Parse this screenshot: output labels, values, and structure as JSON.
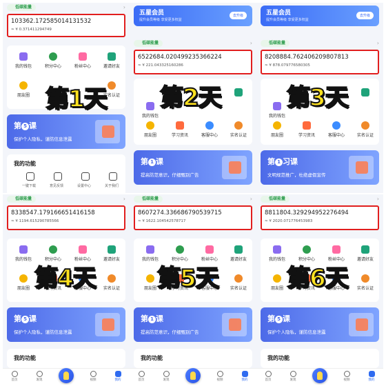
{
  "colors": {
    "accent": "#2f6bf0",
    "highlight_border": "#e11d1d",
    "day_text": "#ffe21f",
    "low_carbon": "#2e9d4f"
  },
  "member": {
    "title": "五星会员",
    "subtitle": "提升会员等级 享受更多权益",
    "button": "去升级"
  },
  "header": {
    "label": "低碳能量"
  },
  "quick": {
    "wallet": "我的钱包",
    "points": "积分中心",
    "fans": "粉丝中心",
    "invite": "邀请好友",
    "moments": "朋友圈",
    "study": "学习资讯",
    "service": "客服中心",
    "realname": "实名认证"
  },
  "my_functions": {
    "title": "我的功能",
    "items": [
      "一键下载",
      "意见反馈",
      "设置中心",
      "关于我们"
    ]
  },
  "tabs": {
    "home": "首页",
    "discover": "发现",
    "mall": "商城",
    "video": "视频",
    "mine": "我的"
  },
  "panels": [
    {
      "day": "第1天",
      "energy": "103362.172585014131532",
      "rmb": "≈ ¥ 0.371411294749",
      "lesson_no": "5",
      "lesson_word": "课",
      "lesson_text": "保护个人隐私，谨防信息泄露"
    },
    {
      "day": "第2天",
      "energy": "6522684.020499235366224",
      "rmb": "≈ ¥ 221.043325160286",
      "lesson_no": "1",
      "lesson_word": "课",
      "lesson_text": "提高防范意识，仔细甄别广告"
    },
    {
      "day": "第3天",
      "energy": "8208884.762406209807813",
      "rmb": "≈ ¥ 878.079776580305",
      "lesson_no": "1",
      "lesson_word": "习课",
      "lesson_text": "文明规范推广，杜绝虚假宣传"
    },
    {
      "day": "第4天",
      "energy": "8338547.179166651416158",
      "rmb": "≈ ¥ 1194.615290785566",
      "lesson_no": "5",
      "lesson_word": "课",
      "lesson_text": "保护个人隐私，谨防信息泄露"
    },
    {
      "day": "第5天",
      "energy": "8607274.336686790539715",
      "rmb": "≈ ¥ 1622.104542578717",
      "lesson_no": "1",
      "lesson_word": "课",
      "lesson_text": "提高防范意识，仔细甄别广告"
    },
    {
      "day": "第6天",
      "energy": "8811804.329294952276494",
      "rmb": "≈ ¥ 2020.071776453983",
      "lesson_no": "5",
      "lesson_word": "课",
      "lesson_text": "保护个人隐私，谨防信息泄露"
    }
  ]
}
